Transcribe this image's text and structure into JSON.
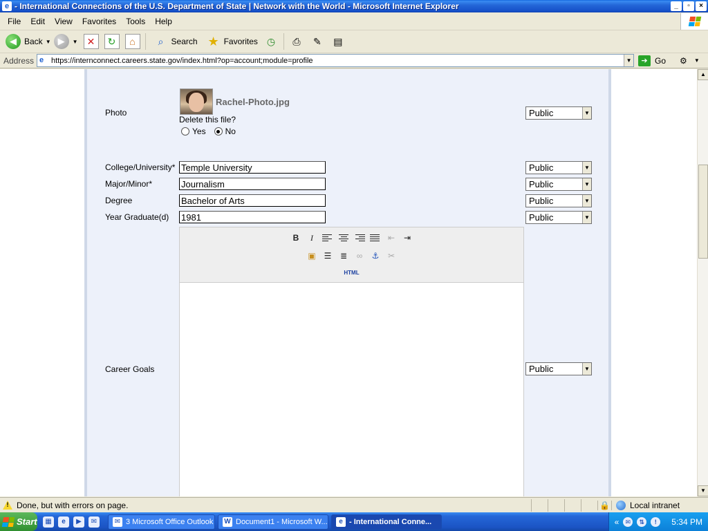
{
  "window": {
    "title": "- International Connections of the U.S. Department of State | Network with the World - Microsoft Internet Explorer",
    "minimize": "_",
    "maximize": "▫",
    "close": "×"
  },
  "menu": [
    "File",
    "Edit",
    "View",
    "Favorites",
    "Tools",
    "Help"
  ],
  "toolbar": {
    "back": "Back",
    "search": "Search",
    "favorites": "Favorites"
  },
  "address": {
    "label": "Address",
    "url": "https://internconnect.careers.state.gov/index.html?op=account;module=profile",
    "go": "Go"
  },
  "form": {
    "photo": {
      "label": "Photo",
      "filename": "Rachel-Photo.jpg",
      "delete_question": "Delete this file?",
      "yes": "Yes",
      "no": "No",
      "selected": "No",
      "privacy": "Public"
    },
    "college": {
      "label": "College/University*",
      "value": "Temple University",
      "privacy": "Public"
    },
    "major": {
      "label": "Major/Minor*",
      "value": "Journalism",
      "privacy": "Public"
    },
    "degree": {
      "label": "Degree",
      "value": "Bachelor of Arts",
      "privacy": "Public"
    },
    "year": {
      "label": "Year Graduate(d)",
      "value": "1981",
      "privacy": "Public"
    },
    "career_goals": {
      "label": "Career Goals",
      "value": "",
      "privacy": "Public"
    }
  },
  "editor": {
    "bold": "B",
    "italic": "I",
    "html": "HTML"
  },
  "status": {
    "text": "Done, but with errors on page.",
    "zone": "Local intranet"
  },
  "taskbar": {
    "start": "Start",
    "tasks": [
      {
        "label": "3 Microsoft Office Outlook",
        "active": false
      },
      {
        "label": "Document1 - Microsoft W...",
        "active": false
      },
      {
        "label": "- International Conne...",
        "active": true
      }
    ],
    "time": "5:34 PM"
  }
}
